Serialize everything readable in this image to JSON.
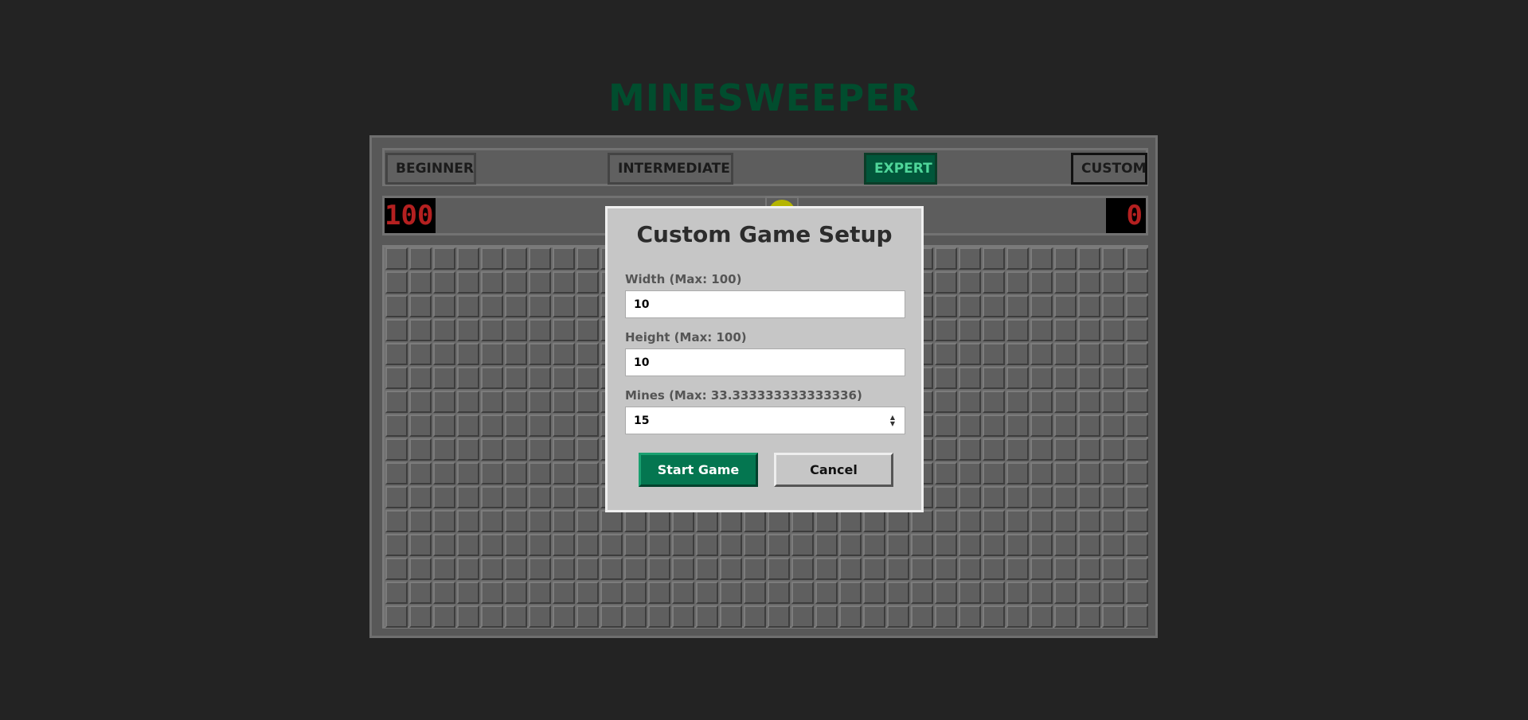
{
  "title": "MINESWEEPER",
  "levels": {
    "beginner": "BEGINNER",
    "intermediate": "INTERMEDIATE",
    "expert": "EXPERT",
    "custom": "CUSTOM",
    "active": "expert"
  },
  "status": {
    "mine_counter": "100",
    "timer": "0",
    "face_icon": "smiley-face-icon"
  },
  "board": {
    "columns": 32,
    "rows": 16
  },
  "modal": {
    "title": "Custom Game Setup",
    "width_label": "Width (Max: 100)",
    "width_value": "10",
    "height_label": "Height (Max: 100)",
    "height_value": "10",
    "mines_label": "Mines (Max: 33.333333333333336)",
    "mines_value": "15",
    "start_label": "Start Game",
    "cancel_label": "Cancel"
  },
  "colors": {
    "background": "#232323",
    "accent": "#047650",
    "title": "#014d2e",
    "counter_digits": "#b42020"
  }
}
